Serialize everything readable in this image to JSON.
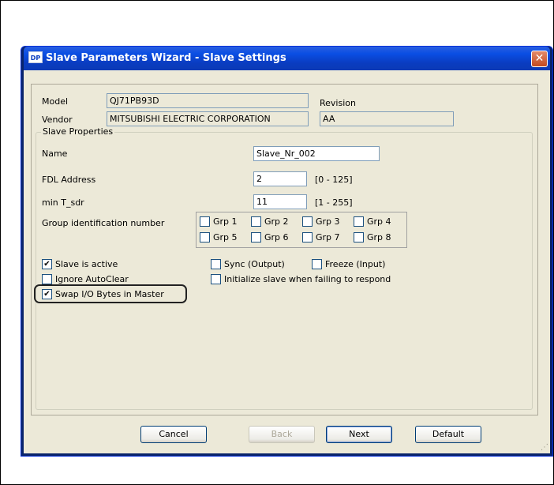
{
  "window": {
    "icon_text": "DP",
    "title": "Slave Parameters Wizard - Slave Settings",
    "close_glyph": "✕"
  },
  "info": {
    "model_label": "Model",
    "model_value": "QJ71PB93D",
    "vendor_label": "Vendor",
    "vendor_value": "MITSUBISHI ELECTRIC CORPORATION",
    "revision_label": "Revision",
    "revision_value": "AA"
  },
  "slave_properties": {
    "legend": "Slave Properties",
    "name_label": "Name",
    "name_value": "Slave_Nr_002",
    "fdl_label": "FDL Address",
    "fdl_value": "2",
    "fdl_range": "[0 - 125]",
    "tsdr_label": "min T_sdr",
    "tsdr_value": "11",
    "tsdr_range": "[1 - 255]",
    "group_label": "Group identification number",
    "groups": [
      "Grp 1",
      "Grp 2",
      "Grp 3",
      "Grp 4",
      "Grp 5",
      "Grp 6",
      "Grp 7",
      "Grp 8"
    ],
    "options": {
      "slave_active": {
        "label": "Slave is active",
        "checked": true
      },
      "ignore_autoclear": {
        "label": "Ignore AutoClear",
        "checked": false
      },
      "swap_io": {
        "label": "Swap I/O Bytes in Master",
        "checked": true
      },
      "sync_output": {
        "label": "Sync (Output)",
        "checked": false
      },
      "freeze_input": {
        "label": "Freeze (Input)",
        "checked": false
      },
      "init_slave": {
        "label": "Initialize slave when failing to respond",
        "checked": false
      }
    },
    "check_glyph": "✔"
  },
  "buttons": {
    "cancel": "Cancel",
    "back": "Back",
    "next": "Next",
    "default": "Default"
  },
  "colors": {
    "titlebar": "#0a3cc0",
    "dialog_bg": "#ece9d8",
    "close_button": "#c44a20"
  },
  "icons": {
    "resize_grip": "⋰"
  }
}
